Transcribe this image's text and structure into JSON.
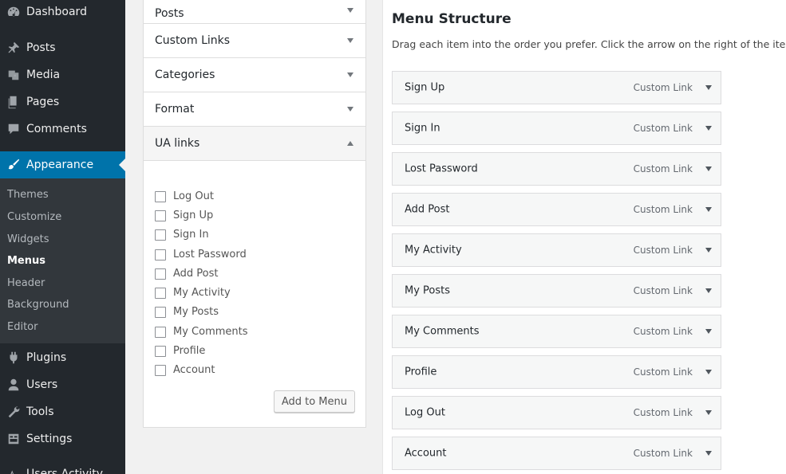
{
  "sidebar": {
    "items": [
      {
        "label": "Dashboard",
        "icon": "dashboard-icon"
      },
      {
        "label": "Posts",
        "icon": "pushpin-icon"
      },
      {
        "label": "Media",
        "icon": "media-icon"
      },
      {
        "label": "Pages",
        "icon": "pages-icon"
      },
      {
        "label": "Comments",
        "icon": "comment-icon"
      },
      {
        "label": "Appearance",
        "icon": "paintbrush-icon"
      },
      {
        "label": "Plugins",
        "icon": "plugin-icon"
      },
      {
        "label": "Users",
        "icon": "user-icon"
      },
      {
        "label": "Tools",
        "icon": "wrench-icon"
      },
      {
        "label": "Settings",
        "icon": "settings-icon"
      },
      {
        "label": "Users Activity",
        "icon": "activity-icon"
      }
    ],
    "submenu": [
      "Themes",
      "Customize",
      "Widgets",
      "Menus",
      "Header",
      "Background",
      "Editor"
    ],
    "active_color": "#0073aa"
  },
  "accordion": {
    "sections": [
      "Posts",
      "Custom Links",
      "Categories",
      "Format",
      "UA links"
    ],
    "ua_links": [
      "Log Out",
      "Sign Up",
      "Sign In",
      "Lost Password",
      "Add Post",
      "My Activity",
      "My Posts",
      "My Comments",
      "Profile",
      "Account"
    ],
    "add_button": "Add to Menu"
  },
  "structure": {
    "title": "Menu Structure",
    "instructions": "Drag each item into the order you prefer. Click the arrow on the right of the item to r",
    "items": [
      {
        "title": "Sign Up",
        "type": "Custom Link"
      },
      {
        "title": "Sign In",
        "type": "Custom Link"
      },
      {
        "title": "Lost Password",
        "type": "Custom Link"
      },
      {
        "title": "Add Post",
        "type": "Custom Link"
      },
      {
        "title": "My Activity",
        "type": "Custom Link"
      },
      {
        "title": "My Posts",
        "type": "Custom Link"
      },
      {
        "title": "My Comments",
        "type": "Custom Link"
      },
      {
        "title": "Profile",
        "type": "Custom Link"
      },
      {
        "title": "Log Out",
        "type": "Custom Link"
      },
      {
        "title": "Account",
        "type": "Custom Link"
      }
    ]
  }
}
